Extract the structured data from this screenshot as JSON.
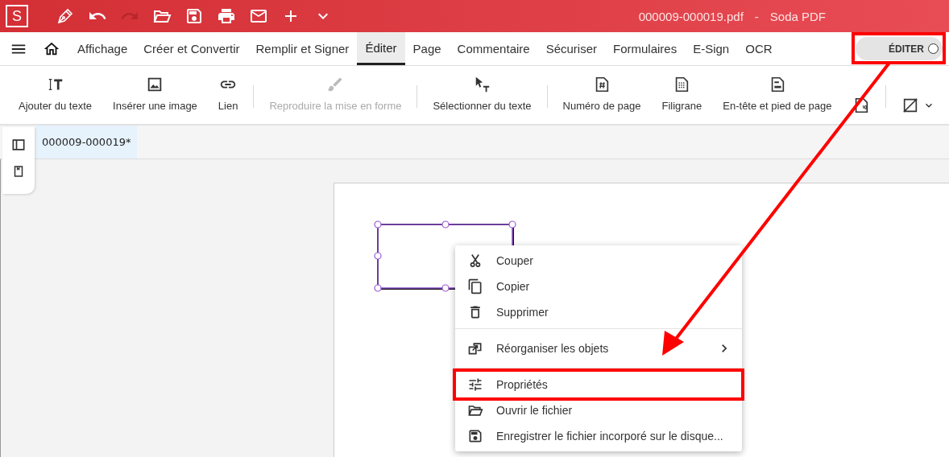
{
  "title_bar": {
    "logo": "S",
    "document_title": "000009-000019.pdf",
    "separator": "-",
    "app_name": "Soda PDF",
    "quick_tools": [
      {
        "kind": "pen",
        "disabled": false
      },
      {
        "kind": "undo",
        "disabled": false
      },
      {
        "kind": "redo",
        "disabled": true
      },
      {
        "kind": "open",
        "disabled": false
      },
      {
        "kind": "save",
        "disabled": false
      },
      {
        "kind": "print",
        "disabled": false
      },
      {
        "kind": "mail",
        "disabled": false
      },
      {
        "kind": "add",
        "disabled": false
      },
      {
        "kind": "more",
        "disabled": false
      }
    ]
  },
  "menu_bar": {
    "tabs": [
      {
        "label": "Affichage",
        "selected": false
      },
      {
        "label": "Créer et Convertir",
        "selected": false
      },
      {
        "label": "Remplir et Signer",
        "selected": false
      },
      {
        "label": "Éditer",
        "selected": true
      },
      {
        "label": "Page",
        "selected": false
      },
      {
        "label": "Commentaire",
        "selected": false
      },
      {
        "label": "Sécuriser",
        "selected": false
      },
      {
        "label": "Formulaires",
        "selected": false
      },
      {
        "label": "E-Sign",
        "selected": false
      },
      {
        "label": "OCR",
        "selected": false
      }
    ],
    "mode_switch": {
      "label": "ÉDITER",
      "annotated": true
    }
  },
  "ribbon": {
    "tools": [
      {
        "kind": "add-text",
        "label": "Ajouter du texte",
        "disabled": false
      },
      {
        "kind": "image",
        "label": "Insérer une image",
        "disabled": false
      },
      {
        "kind": "link",
        "label": "Lien",
        "disabled": false
      },
      {
        "kind": "separator"
      },
      {
        "kind": "brush",
        "label": "Reproduire la mise en forme",
        "disabled": true
      },
      {
        "kind": "separator"
      },
      {
        "kind": "select-text",
        "label": "Sélectionner du texte",
        "disabled": false
      },
      {
        "kind": "separator"
      },
      {
        "kind": "page-number",
        "label": "Numéro de page",
        "disabled": false
      },
      {
        "kind": "watermark",
        "label": "Filigrane",
        "disabled": false
      },
      {
        "kind": "header-footer",
        "label": "En-tête et pied de page",
        "disabled": false
      },
      {
        "kind": "page-badge",
        "disabled": false
      },
      {
        "kind": "separator"
      },
      {
        "kind": "no-fill",
        "disabled": false,
        "dropdown": true
      }
    ]
  },
  "document_tabs": [
    {
      "label": "000009-000019*",
      "selected": true
    }
  ],
  "page": {
    "shape": {
      "kind": "rectangle",
      "selected": true
    }
  },
  "context_menu": {
    "items": [
      {
        "kind": "cut",
        "label": "Couper",
        "submenu": false,
        "annotated": false
      },
      {
        "kind": "copy",
        "label": "Copier",
        "submenu": false,
        "annotated": false
      },
      {
        "kind": "delete",
        "label": "Supprimer",
        "submenu": false,
        "annotated": false
      },
      {
        "kind": "divider"
      },
      {
        "kind": "arrange",
        "label": "Réorganiser les objets",
        "submenu": true,
        "annotated": false
      },
      {
        "kind": "divider"
      },
      {
        "kind": "tune",
        "label": "Propriétés",
        "submenu": false,
        "annotated": true
      },
      {
        "kind": "folder",
        "label": "Ouvrir le fichier",
        "submenu": false,
        "annotated": false
      },
      {
        "kind": "save",
        "label": "Enregistrer le fichier incorporé sur le disque...",
        "submenu": false,
        "annotated": false
      }
    ]
  },
  "annotation_arrow": true
}
